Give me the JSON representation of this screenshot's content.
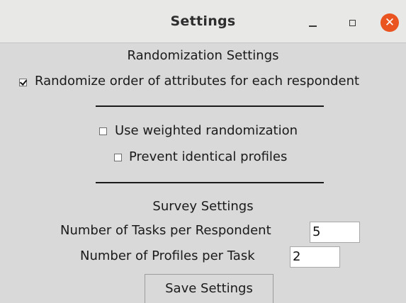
{
  "window": {
    "title": "Settings",
    "minimize_icon": "minimize-icon",
    "maximize_icon": "maximize-icon",
    "close_icon": "close-icon",
    "close_color": "#e95420"
  },
  "randomization": {
    "heading": "Randomization Settings",
    "randomize_order": {
      "label": "Randomize order of attributes for each respondent",
      "checked": true
    },
    "weighted": {
      "label": "Use weighted randomization",
      "checked": false
    },
    "prevent_identical": {
      "label": "Prevent identical profiles",
      "checked": false
    }
  },
  "survey": {
    "heading": "Survey Settings",
    "tasks_label": "Number of Tasks per Respondent",
    "tasks_value": "5",
    "profiles_label": "Number of Profiles per Task",
    "profiles_value": "2",
    "save_label": "Save Settings"
  }
}
